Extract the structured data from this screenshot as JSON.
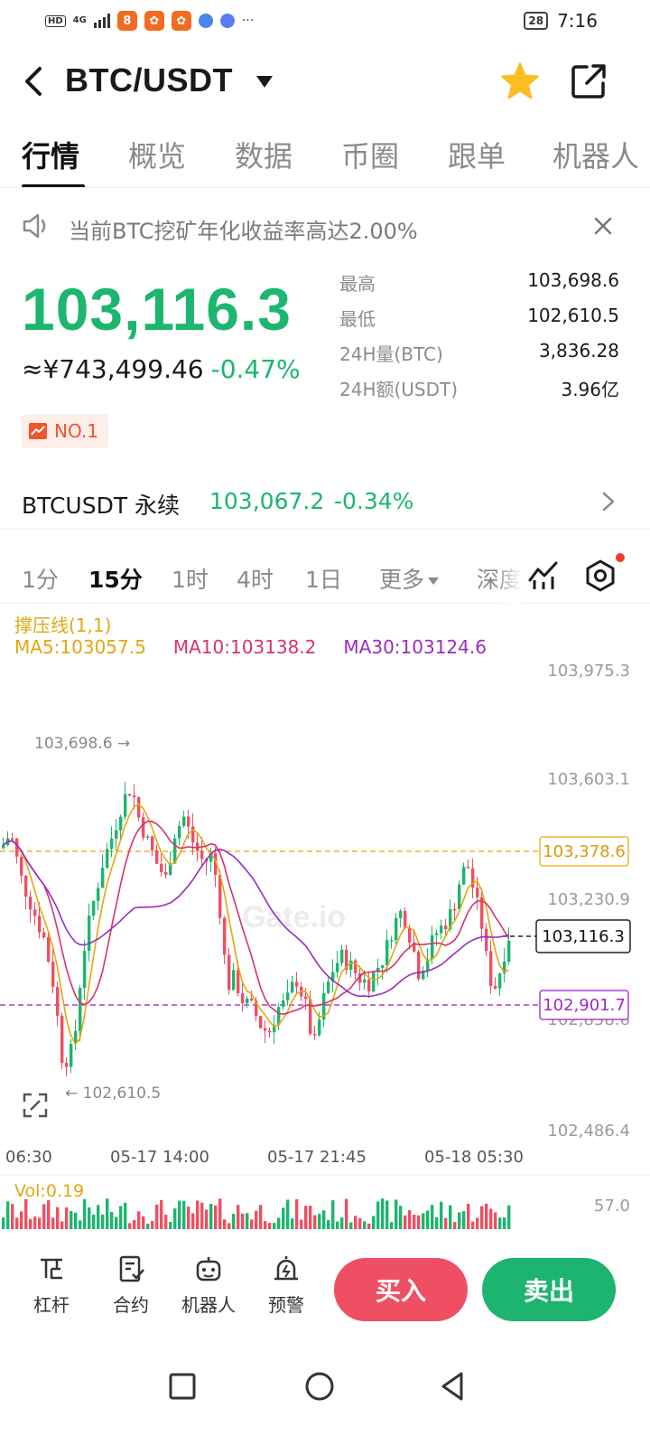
{
  "status_bar": {
    "network": "4G",
    "battery": "28",
    "time": "7:16",
    "more": "···"
  },
  "header": {
    "pair": "BTC/USDT",
    "favorite_color": "#fbbf24"
  },
  "tabs": [
    "行情",
    "概览",
    "数据",
    "币圈",
    "跟单",
    "机器人"
  ],
  "notice": {
    "text": "当前BTC挖矿年化收益率高达2.00%"
  },
  "ticker": {
    "price": "103,116.3",
    "cny": "≈¥743,499.46",
    "change": "-0.47%",
    "rank": "NO.1",
    "stats": [
      {
        "label": "最高",
        "value": "103,698.6"
      },
      {
        "label": "最低",
        "value": "102,610.5"
      },
      {
        "label": "24H量(BTC)",
        "value": "3,836.28"
      },
      {
        "label": "24H额(USDT)",
        "value": "3.96亿"
      }
    ]
  },
  "perpetual": {
    "name": "BTCUSDT 永续",
    "price": "103,067.2",
    "change": "-0.34%"
  },
  "intervals": [
    "1分",
    "15分",
    "1时",
    "4时",
    "1日",
    "更多",
    "深度"
  ],
  "chart": {
    "indicator_title": "撑压线(1,1)",
    "ma5": "MA5:103057.5",
    "ma10": "MA10:103138.2",
    "ma30": "MA30:103124.6",
    "y_ticks": [
      "103,975.3",
      "103,603.1",
      "103,230.9",
      "102,858.6",
      "102,486.4"
    ],
    "x_ticks": [
      "06:30",
      "05-17 14:00",
      "05-17 21:45",
      "05-18 05:30"
    ],
    "high_label": "103,698.6 →",
    "low_label": "← 102,610.5",
    "resistance": "103,378.6",
    "support": "102,901.7",
    "last_price": "103,116.3",
    "watermark": "Gate.io",
    "vol_label": "Vol:0.19",
    "vol_max": "57.0",
    "up_color": "#1cb66e",
    "down_color": "#ef4f63"
  },
  "actions": {
    "items": [
      "杠杆",
      "合约",
      "机器人",
      "预警"
    ],
    "buy": "买入",
    "sell": "卖出"
  }
}
